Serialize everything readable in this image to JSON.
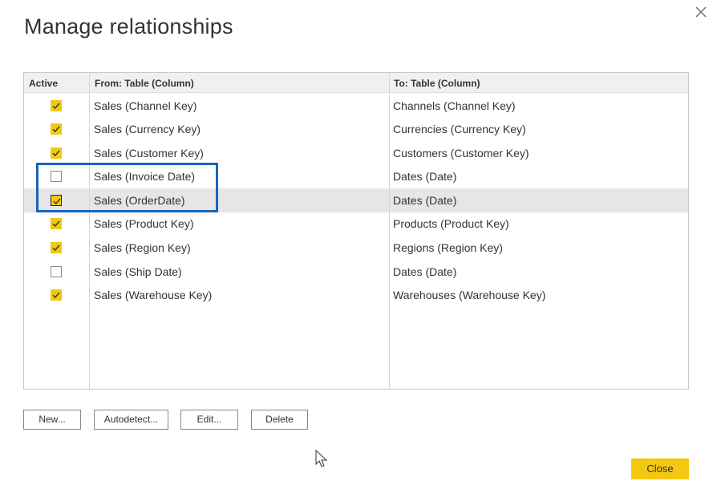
{
  "dialog": {
    "title": "Manage relationships",
    "close_icon": "close-icon"
  },
  "grid": {
    "headers": {
      "active": "Active",
      "from": "From: Table (Column)",
      "to": "To: Table (Column)"
    },
    "rows": [
      {
        "active": true,
        "from": "Sales (Channel Key)",
        "to": "Channels (Channel Key)"
      },
      {
        "active": true,
        "from": "Sales (Currency Key)",
        "to": "Currencies (Currency Key)"
      },
      {
        "active": true,
        "from": "Sales (Customer Key)",
        "to": "Customers (Customer Key)"
      },
      {
        "active": false,
        "from": "Sales (Invoice Date)",
        "to": "Dates (Date)"
      },
      {
        "active": true,
        "from": "Sales (OrderDate)",
        "to": "Dates (Date)",
        "selected": true
      },
      {
        "active": true,
        "from": "Sales (Product Key)",
        "to": "Products (Product Key)"
      },
      {
        "active": true,
        "from": "Sales (Region Key)",
        "to": "Regions (Region Key)"
      },
      {
        "active": false,
        "from": "Sales (Ship Date)",
        "to": "Dates (Date)"
      },
      {
        "active": true,
        "from": "Sales (Warehouse Key)",
        "to": "Warehouses (Warehouse Key)"
      }
    ]
  },
  "buttons": {
    "new": "New...",
    "autodetect": "Autodetect...",
    "edit": "Edit...",
    "delete": "Delete",
    "close": "Close"
  },
  "colors": {
    "accent_yellow": "#f2c811",
    "highlight_blue": "#1565c0",
    "selected_row": "#e6e6e6"
  }
}
